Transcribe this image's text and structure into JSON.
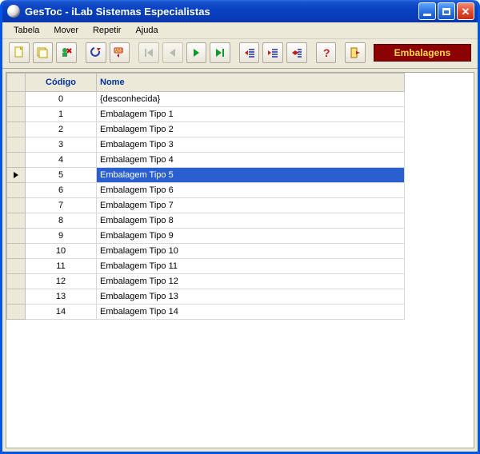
{
  "window": {
    "title": "GesToc - iLab Sistemas Especialistas"
  },
  "menu": {
    "items": [
      "Tabela",
      "Mover",
      "Repetir",
      "Ajuda"
    ]
  },
  "toolbar": {
    "section_label": "Embalagens"
  },
  "grid": {
    "columns": {
      "codigo": "Código",
      "nome": "Nome"
    },
    "selected_index": 5,
    "rows": [
      {
        "codigo": "0",
        "nome": "{desconhecida}"
      },
      {
        "codigo": "1",
        "nome": "Embalagem Tipo 1"
      },
      {
        "codigo": "2",
        "nome": "Embalagem Tipo 2"
      },
      {
        "codigo": "3",
        "nome": "Embalagem Tipo 3"
      },
      {
        "codigo": "4",
        "nome": "Embalagem Tipo 4"
      },
      {
        "codigo": "5",
        "nome": "Embalagem Tipo 5"
      },
      {
        "codigo": "6",
        "nome": "Embalagem Tipo 6"
      },
      {
        "codigo": "7",
        "nome": "Embalagem Tipo 7"
      },
      {
        "codigo": "8",
        "nome": "Embalagem Tipo 8"
      },
      {
        "codigo": "9",
        "nome": "Embalagem Tipo 9"
      },
      {
        "codigo": "10",
        "nome": "Embalagem Tipo 10"
      },
      {
        "codigo": "11",
        "nome": "Embalagem Tipo 11"
      },
      {
        "codigo": "12",
        "nome": "Embalagem Tipo 12"
      },
      {
        "codigo": "13",
        "nome": "Embalagem Tipo 13"
      },
      {
        "codigo": "14",
        "nome": "Embalagem Tipo 14"
      }
    ]
  }
}
